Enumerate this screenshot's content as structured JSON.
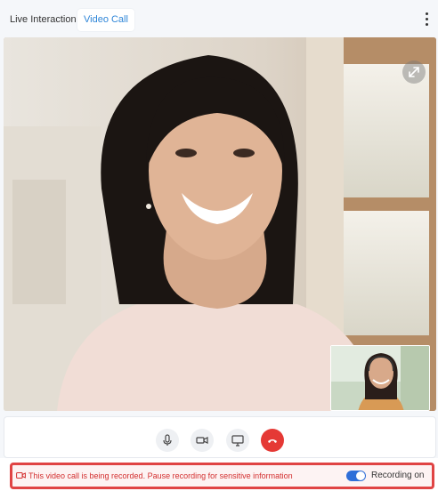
{
  "tabs": [
    {
      "label": "Live Interaction",
      "active": false
    },
    {
      "label": "Video Call",
      "active": true
    }
  ],
  "menu_icon": "more-vertical-icon",
  "video": {
    "main_participant": "remote-participant-video",
    "expand_icon": "expand-icon",
    "self_view": "self-view-video"
  },
  "controls": [
    {
      "name": "microphone",
      "icon": "microphone-icon"
    },
    {
      "name": "camera",
      "icon": "video-camera-icon"
    },
    {
      "name": "screen-share",
      "icon": "screen-share-icon"
    },
    {
      "name": "end-call",
      "icon": "phone-hangup-icon"
    }
  ],
  "recording": {
    "message": "This video call is being recorded. Pause recording for sensitive information",
    "toggle_label": "Recording on",
    "toggle_on": true,
    "icon": "record-camera-icon"
  },
  "colors": {
    "accent": "#2f86d8",
    "toggle": "#2f6fd8",
    "alert": "#d32f2f",
    "end_call": "#e53935"
  }
}
